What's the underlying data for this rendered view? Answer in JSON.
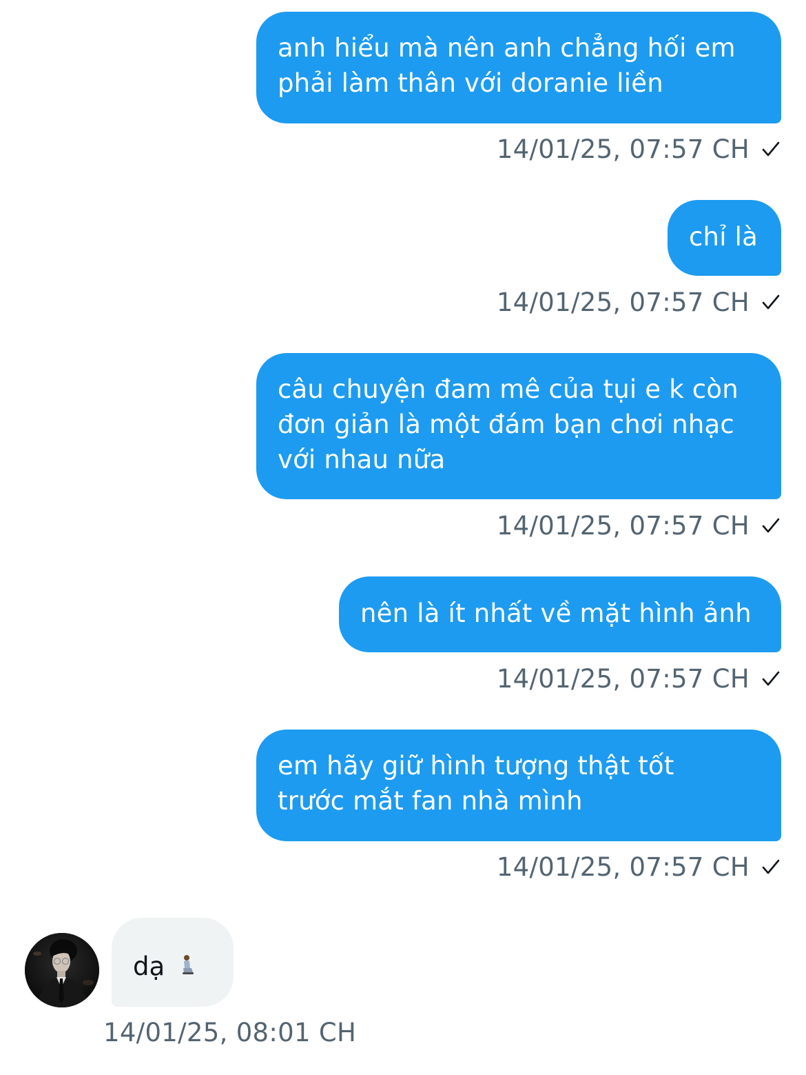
{
  "messages_sent": [
    {
      "text": "anh hiểu mà nên anh chẳng hối em\nphải làm thân với doranie liền",
      "timestamp": "14/01/25, 07:57 CH"
    },
    {
      "text": "chỉ là",
      "timestamp": "14/01/25, 07:57 CH"
    },
    {
      "text": "câu chuyện đam mê của tụi e k còn\nđơn giản là một đám bạn chơi nhạc\nvới nhau nữa",
      "timestamp": "14/01/25, 07:57 CH"
    },
    {
      "text": "nên là ít nhất về mặt hình ảnh",
      "timestamp": "14/01/25, 07:57 CH"
    },
    {
      "text": "em hãy giữ hình tượng thật tốt\ntrước mắt fan nhà mình",
      "timestamp": "14/01/25, 07:57 CH"
    }
  ],
  "message_received": {
    "text": "dạ",
    "emoji": "person-kneeling-emoji",
    "timestamp": "14/01/25, 08:01 CH"
  },
  "colors": {
    "sent_bubble": "#1d9bf0",
    "received_bubble": "#eff3f4",
    "meta_text": "#536471"
  },
  "icons": {
    "sent_status": "check-icon",
    "avatar": "avatar"
  }
}
